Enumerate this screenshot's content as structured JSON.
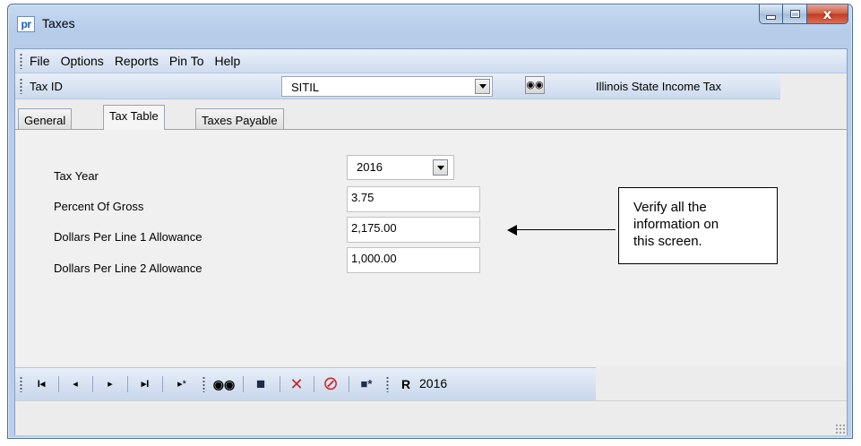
{
  "window": {
    "app_icon_text": "pr",
    "title": "Taxes",
    "close_glyph": "x"
  },
  "menu": {
    "items": [
      "File",
      "Options",
      "Reports",
      "Pin To",
      "Help"
    ]
  },
  "taxbar": {
    "label": "Tax ID",
    "value": "SITIL",
    "description": "Illinois State Income Tax",
    "find_icon": "binoculars-icon"
  },
  "tabs": [
    "General",
    "Tax Table",
    "Taxes Payable"
  ],
  "active_tab": "Tax Table",
  "form": {
    "tax_year_label": "Tax Year",
    "tax_year_value": "2016",
    "percent_label": "Percent Of Gross",
    "percent_value": "3.75",
    "line1_label": "Dollars Per Line 1 Allowance",
    "line1_value": "2,175.00",
    "line2_label": "Dollars Per Line 2 Allowance",
    "line2_value": "1,000.00"
  },
  "callout": {
    "text_line1": "Verify all the",
    "text_line2": "information on",
    "text_line3": "this screen."
  },
  "navbar": {
    "first_glyph": "I◂",
    "prev_glyph": "◂",
    "next_glyph": "▸",
    "last_glyph": "▸I",
    "new_glyph": "▸*",
    "find_glyph": "🔭",
    "save_glyph": "■",
    "delete_glyph": "✕",
    "cancel_glyph": "⊘",
    "save_new_glyph": "■*",
    "report_glyph": "R",
    "year": "2016",
    "colors": {
      "delete": "#c0282d",
      "cancel": "#d21f1f",
      "save": "#1d2c4a"
    }
  }
}
